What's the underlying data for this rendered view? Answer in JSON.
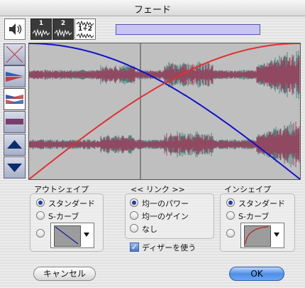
{
  "window": {
    "title": "フェード"
  },
  "toolbar": {
    "speaker_icon": "speaker-icon",
    "ch1_label": "1",
    "ch2_label": "2",
    "ch12_label": "1+2"
  },
  "outshape": {
    "label": "アウトシェイプ",
    "options": [
      "スタンダード",
      "S-カーブ"
    ],
    "selected": 0
  },
  "link": {
    "label": "<< リンク >>",
    "options": [
      "均一のパワー",
      "均一のゲイン",
      "なし"
    ],
    "selected": 0,
    "dither_label": "ディザーを使う",
    "dither_checked": true
  },
  "inshape": {
    "label": "インシェイプ",
    "options": [
      "スタンダード",
      "S-カーブ"
    ],
    "selected": 0
  },
  "buttons": {
    "cancel": "キャンセル",
    "ok": "OK"
  },
  "colors": {
    "fade_out": "#1111cc",
    "fade_in": "#e03030",
    "wave_a": "#2f8a7d",
    "wave_b": "#a03c5c"
  }
}
